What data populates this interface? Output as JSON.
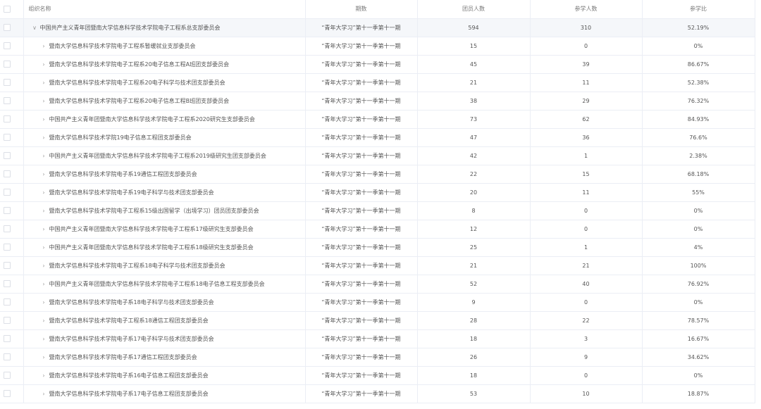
{
  "columns": [
    "组织名称",
    "期数",
    "团员人数",
    "参学人数",
    "参学比"
  ],
  "rows": [
    {
      "name": "中国共产主义青年团暨南大学信息科学技术学院电子工程系总支部委员会",
      "period": "“青年大学习”第十一季第十一期",
      "members": "594",
      "learners": "310",
      "ratio": "52.19%",
      "level": 0,
      "expanded": true
    },
    {
      "name": "暨南大学信息科学技术学院电子工程系暂缓就业支部委员会",
      "period": "“青年大学习”第十一季第十一期",
      "members": "15",
      "learners": "0",
      "ratio": "0%",
      "level": 1
    },
    {
      "name": "暨南大学信息科学技术学院电子工程系20电子信息工程A班团支部委员会",
      "period": "“青年大学习”第十一季第十一期",
      "members": "45",
      "learners": "39",
      "ratio": "86.67%",
      "level": 1
    },
    {
      "name": "暨南大学信息科学技术学院电子工程系20电子科学与技术团支部委员会",
      "period": "“青年大学习”第十一季第十一期",
      "members": "21",
      "learners": "11",
      "ratio": "52.38%",
      "level": 1
    },
    {
      "name": "暨南大学信息科学技术学院电子工程系20电子信息工程B班团支部委员会",
      "period": "“青年大学习”第十一季第十一期",
      "members": "38",
      "learners": "29",
      "ratio": "76.32%",
      "level": 1
    },
    {
      "name": "中国共产主义青年团暨南大学信息科学技术学院电子工程系2020研究生支部委员会",
      "period": "“青年大学习”第十一季第十一期",
      "members": "73",
      "learners": "62",
      "ratio": "84.93%",
      "level": 1
    },
    {
      "name": "暨南大学信息科学技术学院19电子信息工程团支部委员会",
      "period": "“青年大学习”第十一季第十一期",
      "members": "47",
      "learners": "36",
      "ratio": "76.6%",
      "level": 1
    },
    {
      "name": "中国共产主义青年团暨南大学信息科学技术学院电子工程系2019级研究生团支部委员会",
      "period": "“青年大学习”第十一季第十一期",
      "members": "42",
      "learners": "1",
      "ratio": "2.38%",
      "level": 1
    },
    {
      "name": "暨南大学信息科学技术学院电子系19通信工程团支部委员会",
      "period": "“青年大学习”第十一季第十一期",
      "members": "22",
      "learners": "15",
      "ratio": "68.18%",
      "level": 1
    },
    {
      "name": "暨南大学信息科学技术学院电子系19电子科学与技术团支部委员会",
      "period": "“青年大学习”第十一季第十一期",
      "members": "20",
      "learners": "11",
      "ratio": "55%",
      "level": 1
    },
    {
      "name": "暨南大学信息科学技术学院电子工程系15级出国留学（出境学习）团员团支部委员会",
      "period": "“青年大学习”第十一季第十一期",
      "members": "8",
      "learners": "0",
      "ratio": "0%",
      "level": 1
    },
    {
      "name": "中国共产主义青年团暨南大学信息科学技术学院电子工程系17级研究生支部委员会",
      "period": "“青年大学习”第十一季第十一期",
      "members": "12",
      "learners": "0",
      "ratio": "0%",
      "level": 1
    },
    {
      "name": "中国共产主义青年团暨南大学信息科学技术学院电子工程系18级研究生支部委员会",
      "period": "“青年大学习”第十一季第十一期",
      "members": "25",
      "learners": "1",
      "ratio": "4%",
      "level": 1
    },
    {
      "name": "暨南大学信息科学技术学院电子工程系18电子科学与技术团支部委员会",
      "period": "“青年大学习”第十一季第十一期",
      "members": "21",
      "learners": "21",
      "ratio": "100%",
      "level": 1
    },
    {
      "name": "中国共产主义青年团暨南大学信息科学技术学院电子工程系18电子信息工程支部委员会",
      "period": "“青年大学习”第十一季第十一期",
      "members": "52",
      "learners": "40",
      "ratio": "76.92%",
      "level": 1
    },
    {
      "name": "暨南大学信息科学技术学院电子系18电子科学与技术团支部委员会",
      "period": "“青年大学习”第十一季第十一期",
      "members": "9",
      "learners": "0",
      "ratio": "0%",
      "level": 1
    },
    {
      "name": "暨南大学信息科学技术学院电子工程系18通信工程团支部委员会",
      "period": "“青年大学习”第十一季第十一期",
      "members": "28",
      "learners": "22",
      "ratio": "78.57%",
      "level": 1
    },
    {
      "name": "暨南大学信息科学技术学院电子系17电子科学与技术团支部委员会",
      "period": "“青年大学习”第十一季第十一期",
      "members": "18",
      "learners": "3",
      "ratio": "16.67%",
      "level": 1
    },
    {
      "name": "暨南大学信息科学技术学院电子系17通信工程团支部委员会",
      "period": "“青年大学习”第十一季第十一期",
      "members": "26",
      "learners": "9",
      "ratio": "34.62%",
      "level": 1
    },
    {
      "name": "暨南大学信息科学技术学院电子系16电子信息工程团支部委员会",
      "period": "“青年大学习”第十一季第十一期",
      "members": "18",
      "learners": "0",
      "ratio": "0%",
      "level": 1
    },
    {
      "name": "暨南大学信息科学技术学院电子系17电子信息工程团支部委员会",
      "period": "“青年大学习”第十一季第十一期",
      "members": "53",
      "learners": "10",
      "ratio": "18.87%",
      "level": 1
    }
  ],
  "icons": {
    "expanded": "chevron-down-icon",
    "collapsed": "chevron-right-icon",
    "checkbox": "checkbox-icon"
  },
  "colors": {
    "border": "#ebeef5",
    "root_row_bg": "#f5f7fa",
    "text": "#555555"
  }
}
